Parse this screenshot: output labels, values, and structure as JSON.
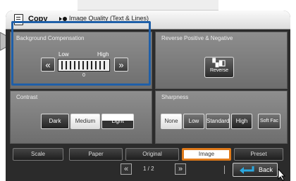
{
  "header": {
    "mode_title": "Copy",
    "screen_title": "Image Quality (Text & Lines)"
  },
  "background_compensation": {
    "title": "Background Compensation",
    "low_label": "Low",
    "high_label": "High",
    "center_label": "0",
    "decrease_symbol": "«",
    "increase_symbol": "»"
  },
  "reverse": {
    "title": "Reverse Positive & Negative",
    "button_label": "Reverse"
  },
  "contrast": {
    "title": "Contrast",
    "options": [
      "Dark",
      "Medium",
      "Light"
    ],
    "selected": "Medium"
  },
  "sharpness": {
    "title": "Sharpness",
    "options": [
      "None",
      "Low",
      "Standard",
      "High",
      "Soft Fac"
    ],
    "selected": "None"
  },
  "tabs": [
    "Scale",
    "Paper",
    "Original",
    "Image",
    "Preset"
  ],
  "active_tab": "Image",
  "pager": {
    "prev_symbol": "«",
    "page_text": "1 / 2",
    "next_symbol": "»"
  },
  "back_label": "Back",
  "colors": {
    "highlight_border": "#1f5fa8",
    "active_tab_border": "#e07a1a",
    "back_arrow": "#2aa8e0"
  }
}
